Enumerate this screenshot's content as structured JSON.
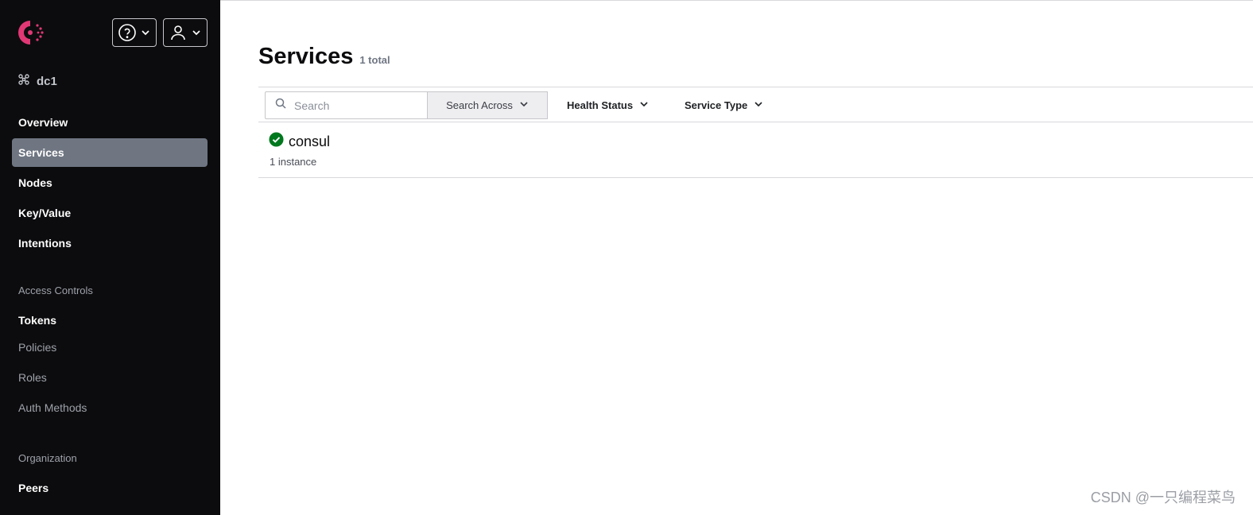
{
  "sidebar": {
    "datacenter": "dc1",
    "nav": [
      {
        "label": "Overview",
        "active": false
      },
      {
        "label": "Services",
        "active": true
      },
      {
        "label": "Nodes",
        "active": false
      },
      {
        "label": "Key/Value",
        "active": false
      },
      {
        "label": "Intentions",
        "active": false
      }
    ],
    "access_controls": {
      "title": "Access Controls",
      "items": [
        "Tokens",
        "Policies",
        "Roles",
        "Auth Methods"
      ]
    },
    "organization": {
      "title": "Organization",
      "items": [
        "Peers"
      ]
    }
  },
  "header": {
    "help_icon": "help-icon",
    "user_icon": "user-icon"
  },
  "main": {
    "title": "Services",
    "total": "1 total",
    "filters": {
      "search_placeholder": "Search",
      "search_across": "Search Across",
      "health_status": "Health Status",
      "service_type": "Service Type"
    },
    "services": [
      {
        "name": "consul",
        "instances": "1 instance",
        "status": "passing"
      }
    ]
  },
  "colors": {
    "brand": "#e03875",
    "sidebar_bg": "#0c0c0e",
    "active_nav": "#6f7682",
    "passing": "#00781e"
  },
  "watermark": "CSDN @一只编程菜鸟"
}
